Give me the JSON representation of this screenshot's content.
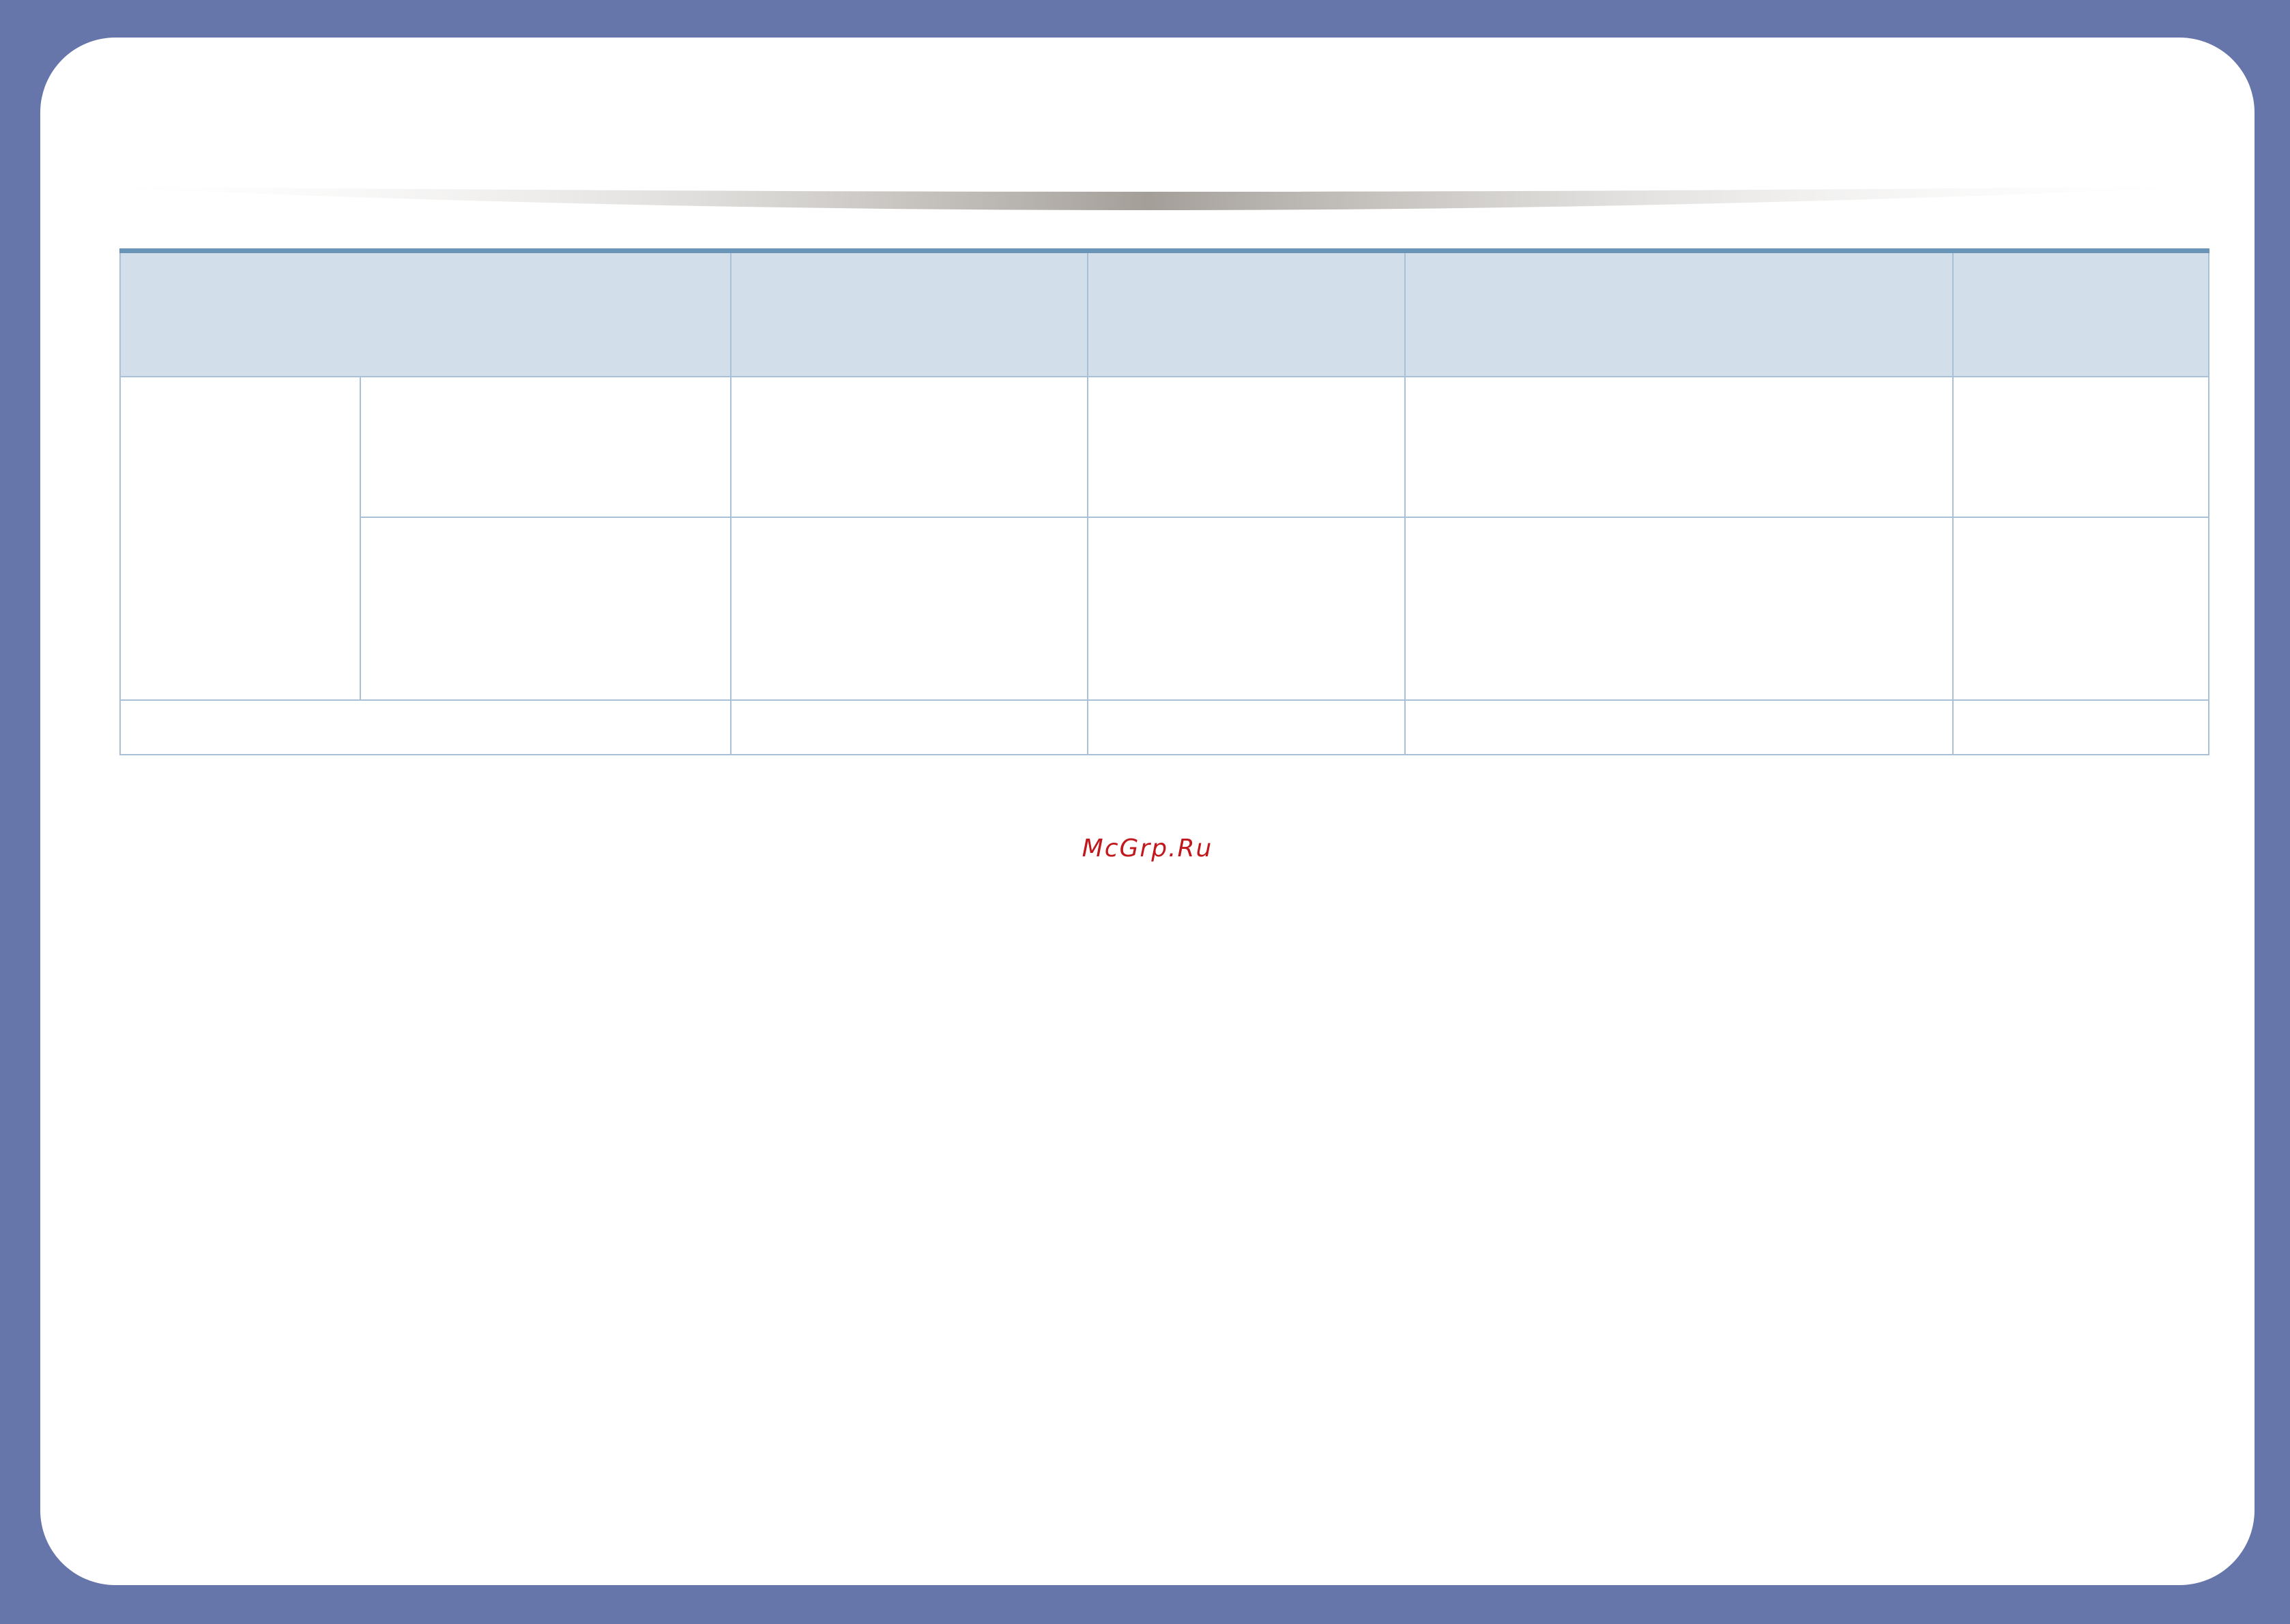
{
  "table": {
    "header": [
      "",
      "",
      "",
      "",
      ""
    ],
    "rows": [
      {
        "group": "",
        "sub": "",
        "cells": [
          "",
          "",
          "",
          ""
        ]
      },
      {
        "sub": "",
        "cells": [
          "",
          "",
          "",
          ""
        ]
      },
      {
        "label": "",
        "cells": [
          "",
          "",
          "",
          ""
        ]
      }
    ]
  },
  "watermark": "McGrp.Ru",
  "colors": {
    "frame": "#6675aa",
    "header_fill": "#d2dfea",
    "header_rule": "#6a95b8",
    "grid": "#a9c0d6",
    "watermark": "#c0181c"
  }
}
